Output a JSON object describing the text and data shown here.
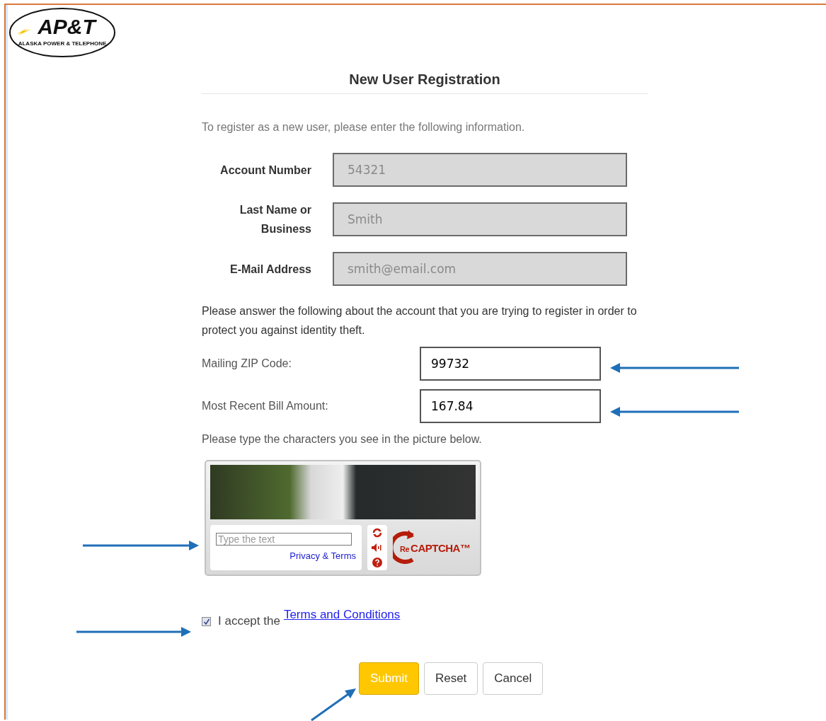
{
  "logo": {
    "mark": "AP&T",
    "tagline": "ALASKA POWER & TELEPHONE"
  },
  "title": "New User Registration",
  "intro": "To register as a new user, please enter the following information.",
  "account_fields": [
    {
      "label": "Account Number",
      "placeholder": "54321",
      "disabled": true
    },
    {
      "label": "Last Name or Business",
      "placeholder": "Smith",
      "disabled": true
    },
    {
      "label": "E-Mail Address",
      "placeholder": "smith@email.com",
      "disabled": true
    }
  ],
  "verification": {
    "prompt": "Please answer the following about the account that you are trying to register in order to protect you against identity theft.",
    "fields": [
      {
        "label": "Mailing ZIP Code:",
        "value": "99732"
      },
      {
        "label": "Most Recent Bill Amount:",
        "value": "167.84"
      }
    ]
  },
  "captcha": {
    "prompt": "Please type the characters you see in the picture below.",
    "placeholder": "Type the text",
    "privacy_link": "Privacy & Terms",
    "brand_prefix": "Re",
    "brand": "CAPTCHA™"
  },
  "terms": {
    "checked": true,
    "label": "I accept the",
    "link": "Terms and Conditions"
  },
  "buttons": [
    {
      "label": "Submit",
      "kind": "primary"
    },
    {
      "label": "Reset",
      "kind": "default"
    },
    {
      "label": "Cancel",
      "kind": "default"
    }
  ]
}
